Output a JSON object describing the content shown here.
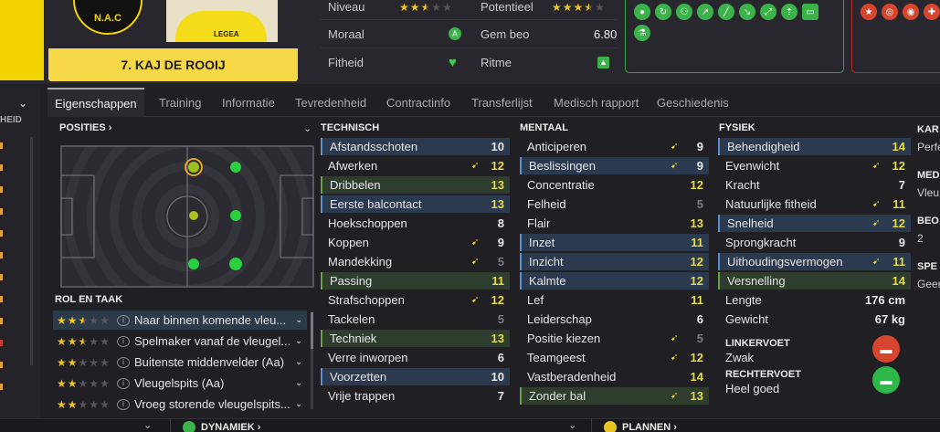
{
  "player": {
    "name_line": "7. KAJ DE ROOIJ",
    "badge_text": "N.A.C",
    "shirt_sponsor": "LEGEA"
  },
  "info": {
    "niveau_label": "Niveau",
    "niveau_stars": 2.5,
    "potentieel_label": "Potentieel",
    "potentieel_stars": 3.5,
    "moraal_label": "Moraal",
    "moraal_icon": "morale-a-icon",
    "gem_beo_label": "Gem beo",
    "gem_beo_value": "6.80",
    "fitheid_label": "Fitheid",
    "fitheid_icon": "heart-icon",
    "ritme_label": "Ritme",
    "ritme_icon": "thumbs-up-icon"
  },
  "tabs": [
    "Eigenschappen",
    "Training",
    "Informatie",
    "Tevredenheid",
    "Contractinfo",
    "Transferlijst",
    "Medisch rapport",
    "Geschiedenis"
  ],
  "sidebar": {
    "header": "HEID"
  },
  "positions": {
    "title": "POSITIES ›"
  },
  "roles": {
    "title": "ROL EN TAAK",
    "items": [
      {
        "stars": 2.5,
        "label": "Naar binnen komende vleu..."
      },
      {
        "stars": 2.5,
        "label": "Spelmaker vanaf de vleugel..."
      },
      {
        "stars": 2,
        "label": "Buitenste middenvelder (Aa)"
      },
      {
        "stars": 2,
        "label": "Vleugelspits (Aa)"
      },
      {
        "stars": 2,
        "label": "Vroeg storende vleugelspits..."
      }
    ]
  },
  "technisch": {
    "title": "TECHNISCH",
    "items": [
      {
        "name": "Afstandsschoten",
        "value": "10",
        "arrow": false,
        "hl": "blue",
        "color": "white"
      },
      {
        "name": "Afwerken",
        "value": "12",
        "arrow": true,
        "hl": "",
        "color": "yellow"
      },
      {
        "name": "Dribbelen",
        "value": "13",
        "arrow": false,
        "hl": "green",
        "color": "yellow"
      },
      {
        "name": "Eerste balcontact",
        "value": "13",
        "arrow": false,
        "hl": "blue",
        "color": "yellow"
      },
      {
        "name": "Hoekschoppen",
        "value": "8",
        "arrow": false,
        "hl": "",
        "color": "white"
      },
      {
        "name": "Koppen",
        "value": "9",
        "arrow": true,
        "hl": "",
        "color": "white"
      },
      {
        "name": "Mandekking",
        "value": "5",
        "arrow": true,
        "hl": "",
        "color": "gray"
      },
      {
        "name": "Passing",
        "value": "11",
        "arrow": false,
        "hl": "green",
        "color": "yellow"
      },
      {
        "name": "Strafschoppen",
        "value": "12",
        "arrow": true,
        "hl": "",
        "color": "yellow"
      },
      {
        "name": "Tackelen",
        "value": "5",
        "arrow": false,
        "hl": "",
        "color": "gray"
      },
      {
        "name": "Techniek",
        "value": "13",
        "arrow": false,
        "hl": "green",
        "color": "yellow"
      },
      {
        "name": "Verre inworpen",
        "value": "6",
        "arrow": false,
        "hl": "",
        "color": "white"
      },
      {
        "name": "Voorzetten",
        "value": "10",
        "arrow": false,
        "hl": "blue",
        "color": "white"
      },
      {
        "name": "Vrije trappen",
        "value": "7",
        "arrow": false,
        "hl": "",
        "color": "white"
      }
    ]
  },
  "mentaal": {
    "title": "MENTAAL",
    "items": [
      {
        "name": "Anticiperen",
        "value": "9",
        "arrow": true,
        "hl": "",
        "color": "white"
      },
      {
        "name": "Beslissingen",
        "value": "9",
        "arrow": true,
        "hl": "blue",
        "color": "white"
      },
      {
        "name": "Concentratie",
        "value": "12",
        "arrow": false,
        "hl": "",
        "color": "yellow"
      },
      {
        "name": "Felheid",
        "value": "5",
        "arrow": false,
        "hl": "",
        "color": "gray"
      },
      {
        "name": "Flair",
        "value": "13",
        "arrow": false,
        "hl": "",
        "color": "yellow"
      },
      {
        "name": "Inzet",
        "value": "11",
        "arrow": false,
        "hl": "blue",
        "color": "yellow"
      },
      {
        "name": "Inzicht",
        "value": "12",
        "arrow": false,
        "hl": "blue",
        "color": "yellow"
      },
      {
        "name": "Kalmte",
        "value": "12",
        "arrow": false,
        "hl": "blue",
        "color": "yellow"
      },
      {
        "name": "Lef",
        "value": "11",
        "arrow": false,
        "hl": "",
        "color": "yellow"
      },
      {
        "name": "Leiderschap",
        "value": "6",
        "arrow": false,
        "hl": "",
        "color": "white"
      },
      {
        "name": "Positie kiezen",
        "value": "5",
        "arrow": true,
        "hl": "",
        "color": "gray"
      },
      {
        "name": "Teamgeest",
        "value": "12",
        "arrow": true,
        "hl": "",
        "color": "yellow"
      },
      {
        "name": "Vastberadenheid",
        "value": "14",
        "arrow": false,
        "hl": "",
        "color": "yellow"
      },
      {
        "name": "Zonder bal",
        "value": "13",
        "arrow": true,
        "hl": "green",
        "color": "yellow"
      }
    ]
  },
  "fysiek": {
    "title": "FYSIEK",
    "items": [
      {
        "name": "Behendigheid",
        "value": "14",
        "arrow": false,
        "hl": "blue",
        "color": "yellow"
      },
      {
        "name": "Evenwicht",
        "value": "12",
        "arrow": true,
        "hl": "",
        "color": "yellow"
      },
      {
        "name": "Kracht",
        "value": "7",
        "arrow": false,
        "hl": "",
        "color": "white"
      },
      {
        "name": "Natuurlijke fitheid",
        "value": "11",
        "arrow": true,
        "hl": "",
        "color": "yellow"
      },
      {
        "name": "Snelheid",
        "value": "12",
        "arrow": true,
        "hl": "blue",
        "color": "yellow"
      },
      {
        "name": "Sprongkracht",
        "value": "9",
        "arrow": false,
        "hl": "",
        "color": "white"
      },
      {
        "name": "Uithoudingsvermogen",
        "value": "11",
        "arrow": true,
        "hl": "blue",
        "color": "yellow"
      },
      {
        "name": "Versnelling",
        "value": "14",
        "arrow": false,
        "hl": "green",
        "color": "yellow"
      },
      {
        "name": "Lengte",
        "value": "176 cm",
        "arrow": false,
        "hl": "",
        "color": "white"
      },
      {
        "name": "Gewicht",
        "value": "67 kg",
        "arrow": false,
        "hl": "",
        "color": "white"
      }
    ],
    "linkervoet_label": "LINKERVOET",
    "linkervoet_value": "Zwak",
    "rechtervoet_label": "RECHTERVOET",
    "rechtervoet_value": "Heel goed"
  },
  "right_column": {
    "kar_label": "KAR",
    "kar_value": "Perfe",
    "med_label": "MED",
    "med_value": "Vleu",
    "beo_label": "BEO",
    "beo_value": "2",
    "spe_label": "SPE",
    "spe_value": "Geer"
  },
  "bottom": {
    "dynamiek": "DYNAMIEK ›",
    "plannen": "PLANNEN ›"
  },
  "colors": {
    "accent_yellow": "#f6d746",
    "highlight_blue": "#2c3a4f",
    "highlight_green": "#2f3d2e",
    "value_yellow": "#e6dc4a",
    "trait_green": "#3bb34a",
    "trait_red": "#d8452e"
  }
}
